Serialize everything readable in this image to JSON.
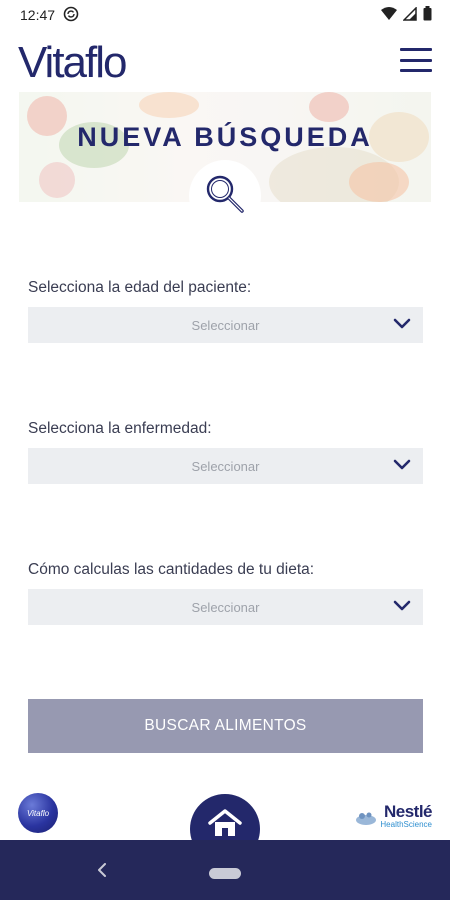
{
  "status_bar": {
    "time": "12:47",
    "icons": [
      "sync-icon",
      "wifi-icon",
      "signal-icon",
      "battery-icon"
    ]
  },
  "header": {
    "logo_text": "Vitaflo",
    "menu_icon": "hamburger-menu-icon"
  },
  "hero": {
    "title": "NUEVA BÚSQUEDA",
    "badge_icon": "search-icon"
  },
  "form": {
    "fields": [
      {
        "label": "Selecciona la edad del paciente:",
        "value": "Seleccionar"
      },
      {
        "label": "Selecciona la enfermedad:",
        "value": "Seleccionar"
      },
      {
        "label": "Cómo calculas las cantidades de tu dieta:",
        "value": "Seleccionar"
      }
    ],
    "submit_label": "BUSCAR ALIMENTOS"
  },
  "footer": {
    "globe_text": "Vitaflo",
    "home_icon": "home-icon",
    "brand_name": "Nestlé",
    "brand_sub": "HealthScience"
  },
  "colors": {
    "brand_navy": "#23286b",
    "button_bg": "#9799b1",
    "select_bg": "#eceef1",
    "nav_bar": "#25285a"
  }
}
